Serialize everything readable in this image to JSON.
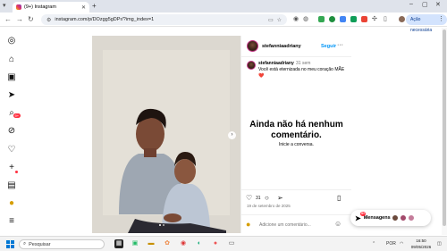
{
  "browser": {
    "tab_title": "(9+) Instagram",
    "new_tab": "+",
    "url": "instagram.com/p/DOzgg5gDPr/?img_index=1",
    "pending_update": "Ação necessária",
    "window_controls": [
      "–",
      "▢",
      "✕"
    ]
  },
  "sidebar": {
    "notification_count": "9+",
    "icons": [
      "instagram-icon",
      "home-icon",
      "reels-icon",
      "messages-icon",
      "search-icon",
      "explore-icon",
      "notifications-icon",
      "create-icon",
      "dashboard-icon",
      "meta-ai-icon",
      "menu-icon",
      "more-icon"
    ]
  },
  "post": {
    "username": "stefanniaadriany",
    "follow_label": "Seguir",
    "more_label": "···",
    "comment_time": "31 sem",
    "caption": "Você está eternizada no meu coração MÃE ❤️",
    "empty_title": "Ainda não há nenhum comentário.",
    "empty_subtitle": "Inicie a conversa.",
    "likes": "31",
    "date": "19 de setembro de 2025",
    "add_comment_placeholder": "Adicione um comentário...",
    "slide_count": 2,
    "current_slide": 1
  },
  "messages": {
    "label": "Mensagens",
    "badge": "9+"
  },
  "taskbar": {
    "search_placeholder": "Pesquisar",
    "language": "POR",
    "time": "16:50",
    "date": "09/05/2026"
  },
  "colors": {
    "accent": "#0095f6",
    "badge": "#ff3040",
    "chrome_tabbar": "#dfe3eb"
  }
}
